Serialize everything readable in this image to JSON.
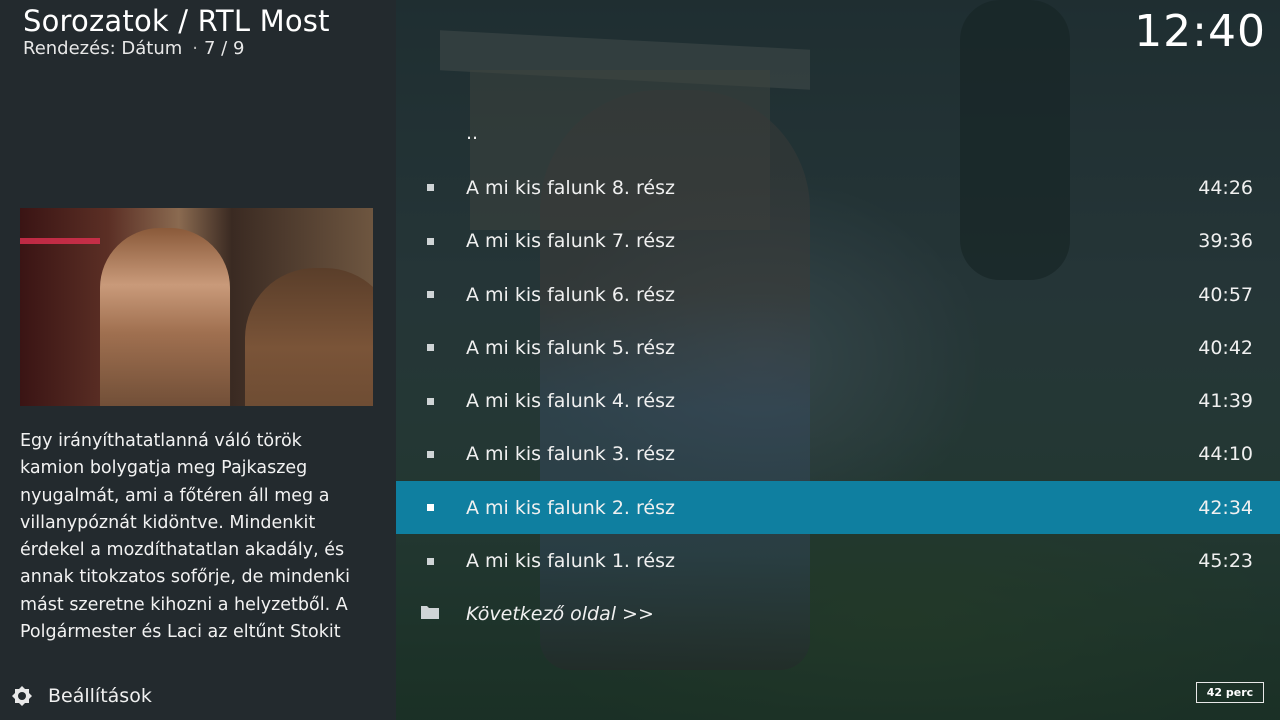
{
  "header": {
    "title": "Sorozatok / RTL Most",
    "sort_label": "Rendezés: Dátum",
    "position": "7 / 9"
  },
  "clock": "12:40",
  "info": {
    "plot": "Egy irányíthatatlanná váló török kamion bolygatja meg Pajkaszeg nyugalmát, ami a főtéren áll meg a villanypóznát kidöntve. Mindenkit érdekel a mozdíthatatlan akadály, és annak titokzatos sofőrje, de mindenki mást szeretne kihozni a helyzetből. A Polgármester és Laci az eltűnt Stokit"
  },
  "list": {
    "parent": "..",
    "items": [
      {
        "title": "A mi kis falunk 8. rész",
        "duration": "44:26"
      },
      {
        "title": "A mi kis falunk 7. rész",
        "duration": "39:36"
      },
      {
        "title": "A mi kis falunk 6. rész",
        "duration": "40:57"
      },
      {
        "title": "A mi kis falunk 5. rész",
        "duration": "40:42"
      },
      {
        "title": "A mi kis falunk 4. rész",
        "duration": "41:39"
      },
      {
        "title": "A mi kis falunk 3. rész",
        "duration": "44:10"
      },
      {
        "title": "A mi kis falunk 2. rész",
        "duration": "42:34"
      },
      {
        "title": "A mi kis falunk 1. rész",
        "duration": "45:23"
      }
    ],
    "next_page": "Következő oldal  >>",
    "selected_index": 6
  },
  "footer": {
    "settings_label": "Beállítások",
    "runtime_badge": "42 perc"
  },
  "colors": {
    "selection": "#0f7fa0",
    "panel": "#232a2e"
  },
  "icons": {
    "settings": "settings-icon",
    "folder": "folder-icon",
    "bullet": "bullet-icon"
  }
}
